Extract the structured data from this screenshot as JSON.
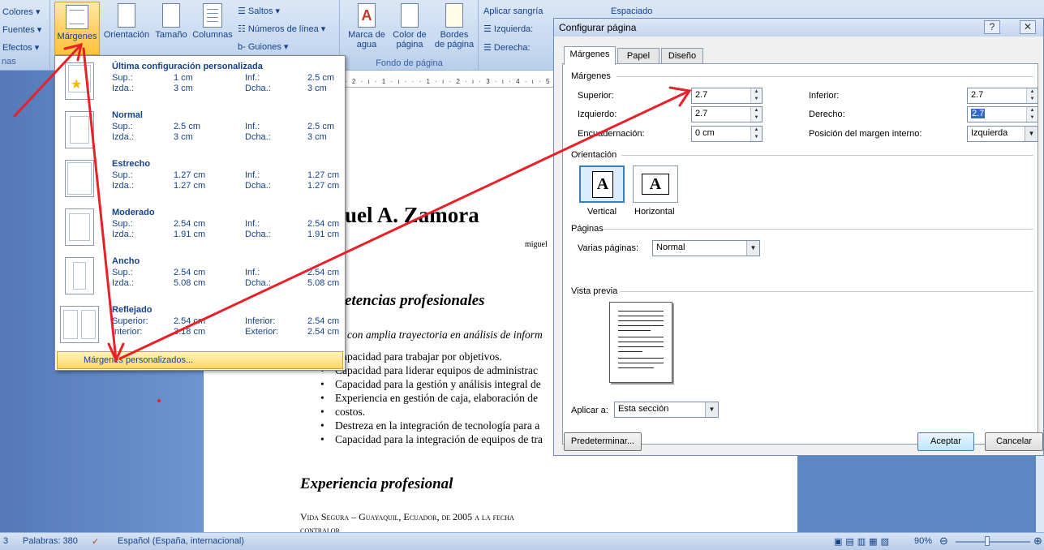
{
  "ribbon": {
    "theme": [
      "Colores",
      "Fuentes",
      "Efectos"
    ],
    "theme_group_label_fragment": "nas",
    "page_setup": {
      "margins": "Márgenes",
      "orientation": "Orientación",
      "size": "Tamaño",
      "columns": "Columnas",
      "breaks": "Saltos",
      "line_numbers": "Números de línea",
      "hyphenation": "Guiones"
    },
    "background": {
      "watermark_line1": "Marca de",
      "watermark_line2": "agua",
      "page_color_line1": "Color de",
      "page_color_line2": "página",
      "borders_line1": "Bordes",
      "borders_line2": "de página",
      "group_label": "Fondo de página"
    },
    "paragraph": {
      "indent_header": "Aplicar sangría",
      "spacing_header": "Espaciado",
      "left": "Izquierda:",
      "right": "Derecha:"
    }
  },
  "dropdown": {
    "presets": [
      {
        "name": "Última configuración personalizada",
        "l1": "Sup.:",
        "v1": "1 cm",
        "l2": "Inf.:",
        "v2": "2.5 cm",
        "l3": "Izda.:",
        "v3": "3 cm",
        "l4": "Dcha.:",
        "v4": "3 cm"
      },
      {
        "name": "Normal",
        "l1": "Sup.:",
        "v1": "2.5 cm",
        "l2": "Inf.:",
        "v2": "2.5 cm",
        "l3": "Izda.:",
        "v3": "3 cm",
        "l4": "Dcha.:",
        "v4": "3 cm"
      },
      {
        "name": "Estrecho",
        "l1": "Sup.:",
        "v1": "1.27 cm",
        "l2": "Inf.:",
        "v2": "1.27 cm",
        "l3": "Izda.:",
        "v3": "1.27 cm",
        "l4": "Dcha.:",
        "v4": "1.27 cm"
      },
      {
        "name": "Moderado",
        "l1": "Sup.:",
        "v1": "2.54 cm",
        "l2": "Inf.:",
        "v2": "2.54 cm",
        "l3": "Izda.:",
        "v3": "1.91 cm",
        "l4": "Dcha.:",
        "v4": "1.91 cm"
      },
      {
        "name": "Ancho",
        "l1": "Sup.:",
        "v1": "2.54 cm",
        "l2": "Inf.:",
        "v2": "2.54 cm",
        "l3": "Izda.:",
        "v3": "5.08 cm",
        "l4": "Dcha.:",
        "v4": "5.08 cm"
      },
      {
        "name": "Reflejado",
        "l1": "Superior:",
        "v1": "2.54 cm",
        "l2": "Inferior:",
        "v2": "2.54 cm",
        "l3": "Interior:",
        "v3": "3.18 cm",
        "l4": "Exterior:",
        "v4": "2.54 cm"
      }
    ],
    "custom": "Márgenes personalizados..."
  },
  "document": {
    "name": "uel A. Zamora",
    "email_fragment": "miguel",
    "heading1": "etencias profesionales",
    "intro": "con amplia trayectoria en análisis de inform",
    "bullets": [
      "Capacidad para trabajar por objetivos.",
      "Capacidad para liderar equipos de administrac",
      "Capacidad para la gestión y análisis integral de",
      "Experiencia en gestión de caja, elaboración de",
      "costos.",
      "Destreza en la integración de tecnología para a",
      "Capacidad para la integración de equipos de tra"
    ],
    "heading2": "Experiencia profesional",
    "job": "Vida Segura – Guayaquil, Ecuador, de 2005 a la fecha",
    "role": "contralor"
  },
  "dialog": {
    "title": "Configurar página",
    "help": "?",
    "close": "✕",
    "tabs": [
      "Márgenes",
      "Papel",
      "Diseño"
    ],
    "margins_section": "Márgenes",
    "superior_label": "Superior:",
    "superior": "2.7",
    "inferior_label": "Inferior:",
    "inferior": "2.7",
    "izquierdo_label": "Izquierdo:",
    "izquierdo": "2.7",
    "derecho_label": "Derecho:",
    "derecho": "2.7",
    "gutter_label": "Encuadernación:",
    "gutter": "0 cm",
    "gutter_pos_label": "Posición del margen interno:",
    "gutter_pos": "Izquierda",
    "orientation_section": "Orientación",
    "vertical": "Vertical",
    "horizontal": "Horizontal",
    "orientation_glyph": "A",
    "pages_section": "Páginas",
    "multiple_pages_label": "Varias páginas:",
    "multiple_pages": "Normal",
    "preview_section": "Vista previa",
    "apply_label": "Aplicar a:",
    "apply_to": "Esta sección",
    "default_btn": "Predeterminar...",
    "ok": "Aceptar",
    "cancel": "Cancelar"
  },
  "status": {
    "page": "3",
    "words": "Palabras: 380",
    "language": "Español (España, internacional)",
    "zoom": "90%"
  },
  "colors": {
    "annotation_arrow": "#e8202a",
    "accent": "#15428b"
  }
}
